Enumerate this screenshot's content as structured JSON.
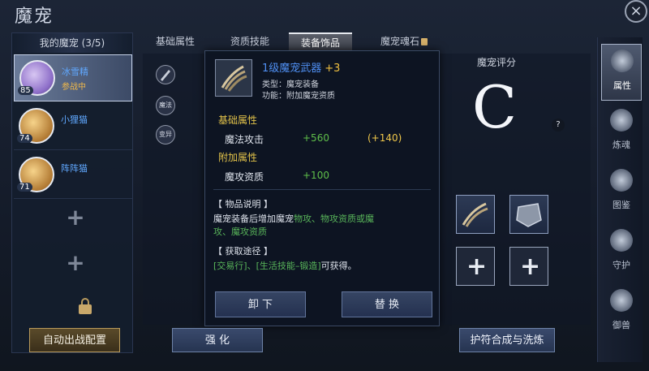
{
  "header": {
    "title": "魔宠",
    "close": "×"
  },
  "left": {
    "title": "我的魔宠 (3/5)",
    "pets": [
      {
        "name": "冰雪精",
        "level": "85",
        "status": "参战中"
      },
      {
        "name": "小狸猫",
        "level": "74",
        "status": ""
      },
      {
        "name": "阵阵猫",
        "level": "71",
        "status": ""
      }
    ],
    "empty_slot": "+",
    "auto_button": "自动出战配置"
  },
  "tabs": [
    {
      "label": "基础属性"
    },
    {
      "label": "资质技能"
    },
    {
      "label": "装备饰品"
    },
    {
      "label": "魔宠魂石"
    }
  ],
  "mini_items": [
    "",
    "魔法",
    "变异"
  ],
  "tooltip": {
    "name": "1级魔宠武器",
    "plus": "+3",
    "type_line": "类型：魔宠装备",
    "func_line": "功能：附加魔宠资质",
    "base_section": "基础属性",
    "base_stats": [
      {
        "label": "魔法攻击",
        "value": "+560",
        "bonus": "(+140)"
      }
    ],
    "extra_section": "附加属性",
    "extra_stats": [
      {
        "label": "魔攻资质",
        "value": "+100"
      }
    ],
    "desc_title": "【 物品说明 】",
    "desc_line1_a": "魔宠装备后增加魔宠",
    "desc_line1_b": "物攻、物攻资质或魔",
    "desc_line2": "攻、魔攻资质",
    "source_title": "【 获取途径 】",
    "source_a": "[交易行]、[生活技能–锻造]",
    "source_b": "可获得。",
    "unequip": "卸 下",
    "replace": "替 换"
  },
  "strengthen_button": "强 化",
  "rating": {
    "title": "魔宠评分",
    "grade": "C",
    "help": "?"
  },
  "equip_plus": "+",
  "synth_button": "护符合成与洗炼",
  "side_nav": [
    {
      "label": "属性",
      "icon": "wolf-emblem-icon"
    },
    {
      "label": "炼魂",
      "icon": "soul-flame-icon"
    },
    {
      "label": "图鉴",
      "icon": "card-book-icon"
    },
    {
      "label": "守护",
      "icon": "vortex-icon"
    },
    {
      "label": "御兽",
      "icon": "beast-mask-icon"
    }
  ]
}
